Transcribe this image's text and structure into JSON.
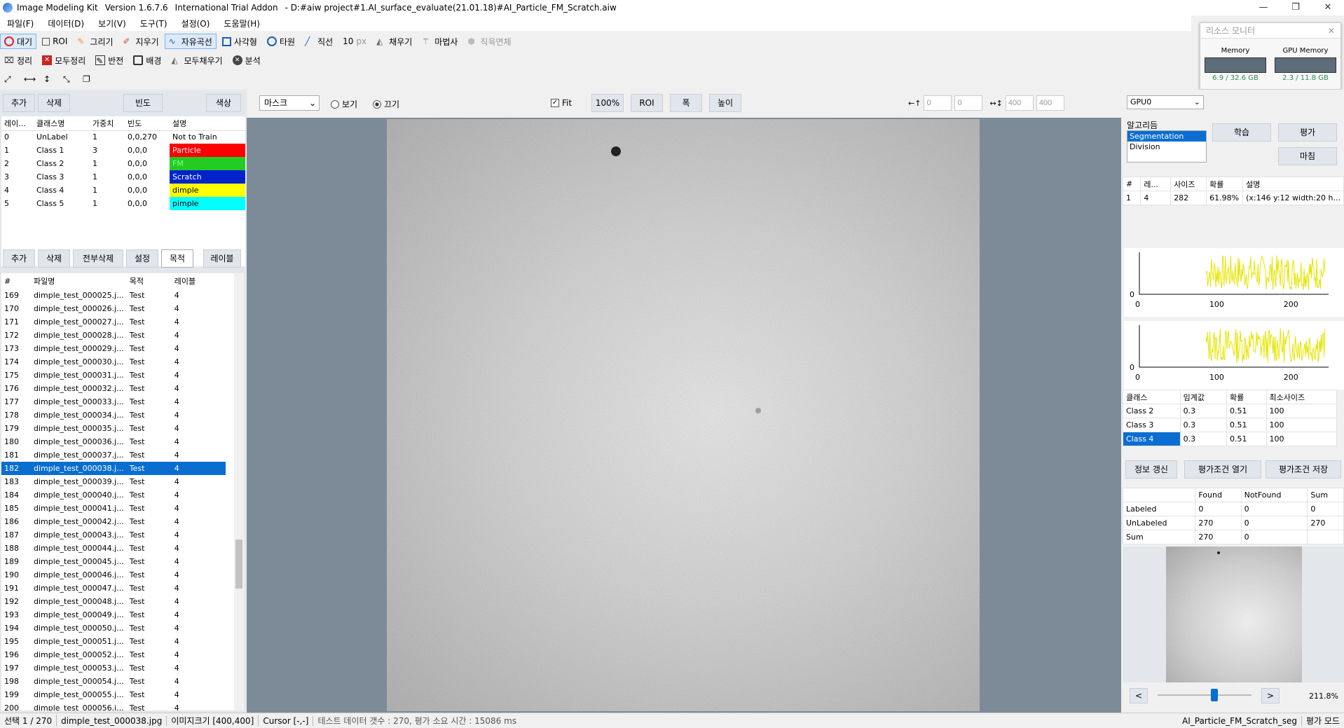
{
  "window": {
    "app": "Image Modeling Kit",
    "version": "Version 1.6.7.6",
    "edition": "International Trial Addon",
    "path": "- D:#aiw project#1.AI_surface_evaluate(21.01.18)#AI_Particle_FM_Scratch.aiw"
  },
  "menu": [
    "파일(F)",
    "데이터(D)",
    "보기(V)",
    "도구(T)",
    "설정(O)",
    "도움말(H)"
  ],
  "toolbar1": {
    "wait": "대기",
    "roi": "ROI",
    "draw": "그리기",
    "erase": "지우기",
    "freecurve": "자유곡선",
    "rect": "사각형",
    "ellipse": "타원",
    "line": "직선",
    "size": "10",
    "unit": "px",
    "fill": "채우기",
    "magic": "마법사",
    "rectdelete": "직육면체"
  },
  "toolbar2": {
    "clean": "정리",
    "cleanall": "모두정리",
    "invert": "반전",
    "background": "배경",
    "fillall": "모두채우기",
    "analyze": "분석"
  },
  "resource": {
    "title": "리소스 모니터",
    "memory_label": "Memory",
    "memory_val": "6.9 / 32.6 GB",
    "gpu_label": "GPU Memory",
    "gpu_val": "2.3 / 11.8 GB"
  },
  "classpanel": {
    "add": "추가",
    "del": "삭제",
    "freq": "빈도",
    "color": "색상",
    "headers": [
      "레이...",
      "클래스명",
      "가중치",
      "빈도",
      "설명"
    ],
    "rows": [
      {
        "id": "0",
        "name": "UnLabel",
        "w": "1",
        "f": "0,0,270",
        "desc": "Not to Train",
        "color": "#ffffff",
        "txt": "#000"
      },
      {
        "id": "1",
        "name": "Class 1",
        "w": "3",
        "f": "0,0,0",
        "desc": "Particle",
        "color": "#ff0000",
        "txt": "#fff"
      },
      {
        "id": "2",
        "name": "Class 2",
        "w": "1",
        "f": "0,0,0",
        "desc": "FM",
        "color": "#22cc22",
        "txt": "#8f8"
      },
      {
        "id": "3",
        "name": "Class 3",
        "w": "1",
        "f": "0,0,0",
        "desc": "Scratch",
        "color": "#0022cc",
        "txt": "#fff"
      },
      {
        "id": "4",
        "name": "Class 4",
        "w": "1",
        "f": "0,0,0",
        "desc": "dimple",
        "color": "#ffff00",
        "txt": "#000"
      },
      {
        "id": "5",
        "name": "Class 5",
        "w": "1",
        "f": "0,0,0",
        "desc": "pimple",
        "color": "#00ffff",
        "txt": "#000"
      }
    ]
  },
  "filepanel": {
    "add": "추가",
    "del": "삭제",
    "delall": "전부삭제",
    "settings": "설정",
    "purpose": "목적",
    "label": "레이블",
    "headers": [
      "#",
      "파일명",
      "목적",
      "레이블"
    ],
    "rows": [
      [
        "169",
        "dimple_test_000025.j...",
        "Test",
        "4"
      ],
      [
        "170",
        "dimple_test_000026.j...",
        "Test",
        "4"
      ],
      [
        "171",
        "dimple_test_000027.j...",
        "Test",
        "4"
      ],
      [
        "172",
        "dimple_test_000028.j...",
        "Test",
        "4"
      ],
      [
        "173",
        "dimple_test_000029.j...",
        "Test",
        "4"
      ],
      [
        "174",
        "dimple_test_000030.j...",
        "Test",
        "4"
      ],
      [
        "175",
        "dimple_test_000031.j...",
        "Test",
        "4"
      ],
      [
        "176",
        "dimple_test_000032.j...",
        "Test",
        "4"
      ],
      [
        "177",
        "dimple_test_000033.j...",
        "Test",
        "4"
      ],
      [
        "178",
        "dimple_test_000034.j...",
        "Test",
        "4"
      ],
      [
        "179",
        "dimple_test_000035.j...",
        "Test",
        "4"
      ],
      [
        "180",
        "dimple_test_000036.j...",
        "Test",
        "4"
      ],
      [
        "181",
        "dimple_test_000037.j...",
        "Test",
        "4"
      ],
      [
        "182",
        "dimple_test_000038.j...",
        "Test",
        "4"
      ],
      [
        "183",
        "dimple_test_000039.j...",
        "Test",
        "4"
      ],
      [
        "184",
        "dimple_test_000040.j...",
        "Test",
        "4"
      ],
      [
        "185",
        "dimple_test_000041.j...",
        "Test",
        "4"
      ],
      [
        "186",
        "dimple_test_000042.j...",
        "Test",
        "4"
      ],
      [
        "187",
        "dimple_test_000043.j...",
        "Test",
        "4"
      ],
      [
        "188",
        "dimple_test_000044.j...",
        "Test",
        "4"
      ],
      [
        "189",
        "dimple_test_000045.j...",
        "Test",
        "4"
      ],
      [
        "190",
        "dimple_test_000046.j...",
        "Test",
        "4"
      ],
      [
        "191",
        "dimple_test_000047.j...",
        "Test",
        "4"
      ],
      [
        "192",
        "dimple_test_000048.j...",
        "Test",
        "4"
      ],
      [
        "193",
        "dimple_test_000049.j...",
        "Test",
        "4"
      ],
      [
        "194",
        "dimple_test_000050.j...",
        "Test",
        "4"
      ],
      [
        "195",
        "dimple_test_000051.j...",
        "Test",
        "4"
      ],
      [
        "196",
        "dimple_test_000052.j...",
        "Test",
        "4"
      ],
      [
        "197",
        "dimple_test_000053.j...",
        "Test",
        "4"
      ],
      [
        "198",
        "dimple_test_000054.j...",
        "Test",
        "4"
      ],
      [
        "199",
        "dimple_test_000055.j...",
        "Test",
        "4"
      ],
      [
        "200",
        "dimple_test_000056.j...",
        "Test",
        "4"
      ]
    ],
    "selected": "182"
  },
  "viewbar": {
    "mask": "마스크",
    "view": "보기",
    "hide": "끄기",
    "fit": "Fit",
    "zoom100": "100%",
    "roi": "ROI",
    "width": "폭",
    "height": "높이",
    "x": "0",
    "y": "0",
    "w": "400",
    "h": "400"
  },
  "right": {
    "gpu": "GPU0",
    "algo_label": "알고리듬",
    "algos": [
      "Segmentation",
      "Division"
    ],
    "train": "학습",
    "eval": "평가",
    "finish": "마침",
    "result_headers": [
      "#",
      "레...",
      "사이즈",
      "확률",
      "설명"
    ],
    "result_rows": [
      [
        "1",
        "4",
        "282",
        "61.98%",
        "(x:146 y:12 width:20 h..."
      ]
    ],
    "hist_ticks": [
      "0",
      "100",
      "200"
    ],
    "hist_y": "0",
    "thr_headers": [
      "클래스",
      "임계값",
      "확률",
      "최소사이즈"
    ],
    "thr_rows": [
      [
        "Class 2",
        "0.3",
        "0.51",
        "100"
      ],
      [
        "Class 3",
        "0.3",
        "0.51",
        "100"
      ],
      [
        "Class 4",
        "0.3",
        "0.51",
        "100"
      ]
    ],
    "btn_refresh": "정보 갱신",
    "btn_open": "평가조건 열기",
    "btn_save": "평가조건 저장",
    "sum_headers": [
      "",
      "Found",
      "NotFound",
      "Sum"
    ],
    "sum_rows": [
      [
        "Labeled",
        "0",
        "0",
        "0"
      ],
      [
        "UnLabeled",
        "270",
        "0",
        "270"
      ],
      [
        "Sum",
        "270",
        "0",
        ""
      ]
    ],
    "prev": "<",
    "next": ">",
    "zoom": "211.8%"
  },
  "status": {
    "sel": "선택 1 / 270",
    "file": "dimple_test_000038.jpg",
    "size": "이미지크기 [400,400]",
    "cursor": "Cursor [-,-]",
    "info": "테스트 데이터 갯수 : 270,  평가 소요 시간 : 15086 ms",
    "model": "AI_Particle_FM_Scratch_seg",
    "mode": "평가 모드"
  }
}
